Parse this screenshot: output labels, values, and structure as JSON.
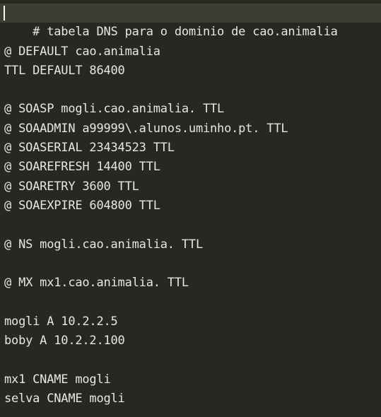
{
  "editor": {
    "lines": [
      "# tabela DNS para o dominio de cao.animalia",
      "",
      "@ DEFAULT cao.animalia",
      "TTL DEFAULT 86400",
      "",
      "@ SOASP mogli.cao.animalia. TTL",
      "@ SOAADMIN a99999\\.alunos.uminho.pt. TTL",
      "@ SOASERIAL 23434523 TTL",
      "@ SOAREFRESH 14400 TTL",
      "@ SOARETRY 3600 TTL",
      "@ SOAEXPIRE 604800 TTL",
      "",
      "@ NS mogli.cao.animalia. TTL",
      "",
      "@ MX mx1.cao.animalia. TTL",
      "",
      "mogli A 10.2.2.5",
      "boby A 10.2.2.100",
      "",
      "mx1 CNAME mogli",
      "selva CNAME mogli"
    ]
  }
}
